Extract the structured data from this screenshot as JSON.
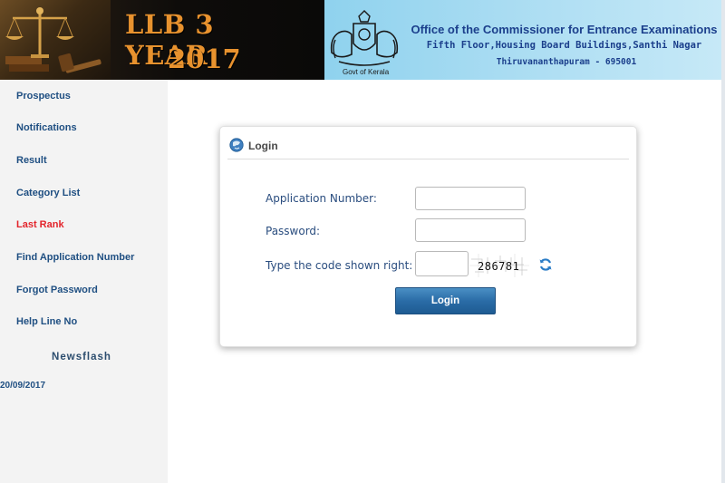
{
  "header": {
    "title_line1": "LLB 3 YEAR",
    "title_line2": "2017",
    "emblem_caption": "Govt of Kerala",
    "office_name": "Office of the Commissioner for Entrance Examinations",
    "address_line1": "Fifth Floor,Housing Board Buildings,Santhi Nagar",
    "address_line2": "Thiruvananthapuram - 695001"
  },
  "sidebar": {
    "items": [
      {
        "label": "Prospectus",
        "active": false
      },
      {
        "label": "Notifications",
        "active": false
      },
      {
        "label": "Result",
        "active": false
      },
      {
        "label": "Category List",
        "active": false
      },
      {
        "label": "Last Rank",
        "active": true
      },
      {
        "label": "Find Application Number",
        "active": false
      },
      {
        "label": "Forgot Password",
        "active": false
      },
      {
        "label": "Help Line No",
        "active": false
      }
    ],
    "newsflash_title": "Newsflash",
    "newsflash_date": "20/09/2017"
  },
  "login": {
    "title": "Login",
    "fields": [
      {
        "label": "Application Number:",
        "value": ""
      },
      {
        "label": "Password:",
        "value": ""
      },
      {
        "label": "Type the code shown right:",
        "value": ""
      }
    ],
    "captcha_code": "286781",
    "button_label": "Login"
  },
  "colors": {
    "menu_link": "#1f4f82",
    "menu_active": "#e3242b",
    "title_orange": "#e8922e",
    "office_blue": "#1b3f8c",
    "button_blue": "#2a6ca7"
  },
  "icons": {
    "panel_icon": "login-globe-icon",
    "refresh_icon": "refresh-icon",
    "emblem": "kerala-emblem-icon",
    "banner_art": "scales-of-justice-icon"
  }
}
